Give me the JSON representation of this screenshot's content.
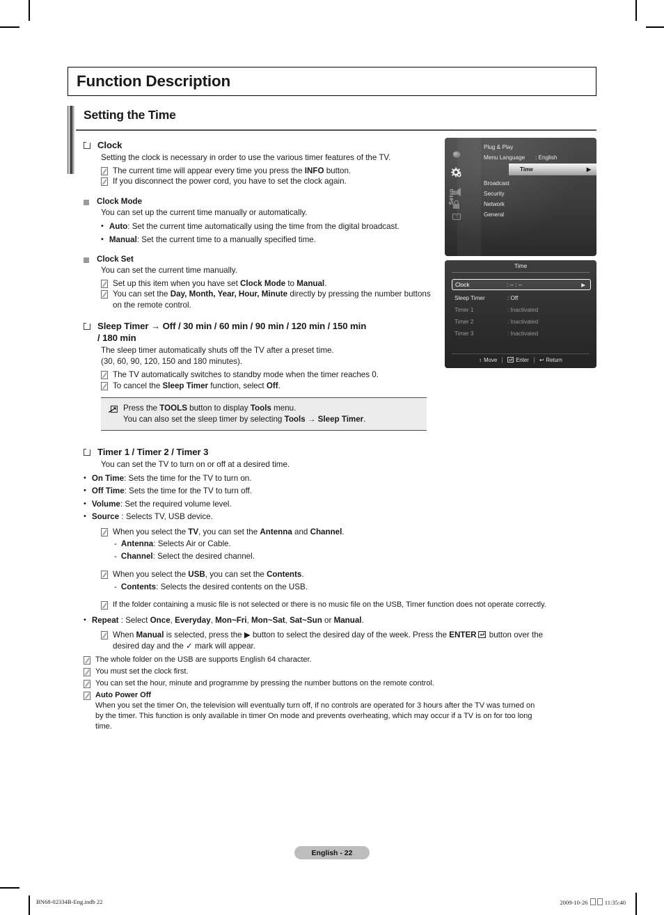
{
  "header": {
    "title": "Function Description",
    "section_title": "Setting the Time"
  },
  "clock": {
    "heading": "Clock",
    "intro": "Setting the clock is necessary in order to use the various timer features of the TV.",
    "notes": [
      {
        "pre": "The current time will appear every time you press the ",
        "b": "INFO",
        "post": " button."
      },
      {
        "pre": "If you disconnect the power cord, you have to set the clock again.",
        "b": "",
        "post": ""
      }
    ]
  },
  "clock_mode": {
    "heading": "Clock Mode",
    "desc": "You can set up the current time manually or automatically.",
    "options": [
      {
        "label": "Auto",
        "text": ": Set the current time automatically using the time from the digital broadcast."
      },
      {
        "label": "Manual",
        "text": ": Set the current time to a manually specified time."
      }
    ]
  },
  "clock_set": {
    "heading": "Clock Set",
    "desc": "You can set the current time manually.",
    "note1_a": "Set up this item when you have set ",
    "note1_b": "Clock Mode",
    "note1_c": " to ",
    "note1_d": "Manual",
    "note1_e": ".",
    "note2_a": "You can set the ",
    "note2_b": "Day, Month, Year, Hour, Minute",
    "note2_c": " directly by pressing the number buttons on the remote control."
  },
  "sleep_timer": {
    "heading_line1": "Sleep Timer → Off / 30 min / 60 min / 90 min / 120 min / 150 min",
    "heading_line2": "/ 180 min",
    "desc_line1": "The sleep timer automatically shuts off the TV after a preset time.",
    "desc_line2": "(30, 60, 90, 120, 150 and 180 minutes).",
    "note1": "The TV automatically switches to standby mode when the timer reaches 0.",
    "note2_a": "To cancel the ",
    "note2_b": "Sleep Timer",
    "note2_c": " function, select ",
    "note2_d": "Off",
    "note2_e": "."
  },
  "tools_note": {
    "line1_a": "Press the ",
    "line1_b": "TOOLS",
    "line1_c": " button to display ",
    "line1_d": "Tools",
    "line1_e": " menu.",
    "line2_a": "You can also set the sleep timer by selecting ",
    "line2_b": "Tools → Sleep Timer",
    "line2_c": "."
  },
  "timers": {
    "heading": "Timer 1 / Timer 2 / Timer 3",
    "desc": "You can set the TV to turn on or off at a desired time.",
    "items": [
      {
        "label": "On Time",
        "text": ": Sets the time for the TV to turn on."
      },
      {
        "label": "Off Time",
        "text": ": Sets the time for the TV to turn off."
      },
      {
        "label": "Volume",
        "text": ": Set the required volume level."
      },
      {
        "label": "Source",
        "text": " : Selects TV, USB device."
      }
    ],
    "tv_note_a": "When you select the ",
    "tv_note_b": "TV",
    "tv_note_c": ", you can set the ",
    "tv_note_d": "Antenna",
    "tv_note_e": " and ",
    "tv_note_f": "Channel",
    "tv_note_g": ".",
    "antenna_label": "Antenna",
    "antenna_text": ": Selects Air or Cable.",
    "channel_label": "Channel",
    "channel_text": ": Select the desired channel.",
    "usb_note_a": "When you select the ",
    "usb_note_b": "USB",
    "usb_note_c": ", you can set the ",
    "usb_note_d": "Contents",
    "usb_note_e": ".",
    "contents_label": "Contents",
    "contents_text": ": Selects the desired contents on the USB.",
    "folder_note": "If the folder containing a music file is not selected or there is no music file on the USB, Timer function does not operate correctly.",
    "repeat_label": "Repeat",
    "repeat_a": " : Select ",
    "repeat_opts": [
      "Once",
      "Everyday",
      "Mon~Fri",
      "Mon~Sat",
      "Sat~Sun"
    ],
    "repeat_or": " or ",
    "repeat_manual": "Manual",
    "repeat_end": ".",
    "manual_note_a": "When ",
    "manual_note_b": "Manual",
    "manual_note_c": " is selected, press the ▶ button to select the desired day of the week. Press the ",
    "manual_note_d": "ENTER",
    "manual_note_e": " button over the",
    "manual_note_f": "desired day and the ✓ mark will appear."
  },
  "final_notes": {
    "n1": "The whole folder on the USB are supports English 64 character.",
    "n2": "You must set the clock first.",
    "n3": "You can set the hour, minute and programme by pressing the number buttons on the remote control.",
    "n4_heading": "Auto Power Off",
    "n4_line1": "When you set the timer On, the television will eventually turn off, if no controls are operated for 3 hours after the TV was turned on",
    "n4_line2": "by the timer. This function is only available in timer On mode and prevents overheating, which may occur if a TV is on for too long",
    "n4_line3": "time."
  },
  "osd_setup": {
    "rail_label": "Setup",
    "items": [
      {
        "label": "Plug & Play",
        "value": ""
      },
      {
        "label": "Menu Language",
        "value": ": English"
      },
      {
        "label": "Time",
        "value": "",
        "selected": true
      },
      {
        "label": "Broadcast",
        "value": ""
      },
      {
        "label": "Security",
        "value": ""
      },
      {
        "label": "Network",
        "value": ""
      },
      {
        "label": "General",
        "value": ""
      }
    ],
    "arrow": "▶"
  },
  "osd_time": {
    "title": "Time",
    "rows": [
      {
        "label": "Clock",
        "value": ": -- : --",
        "selected": true,
        "dim": false
      },
      {
        "label": "Sleep Timer",
        "value": ": Off",
        "selected": false,
        "dim": false
      },
      {
        "label": "Timer 1",
        "value": ": Inactivated",
        "selected": false,
        "dim": true
      },
      {
        "label": "Timer 2",
        "value": ": Inactivated",
        "selected": false,
        "dim": true
      },
      {
        "label": "Timer 3",
        "value": ": Inactivated",
        "selected": false,
        "dim": true
      }
    ],
    "arrow": "▶",
    "footer": {
      "move": "Move",
      "enter": "Enter",
      "return": "Return"
    }
  },
  "footer": {
    "page_label": "English - 22",
    "print_left": "BN68-02334B-Eng.indb   22",
    "print_date": "2009-10-26",
    "print_time": "11:35:40"
  }
}
